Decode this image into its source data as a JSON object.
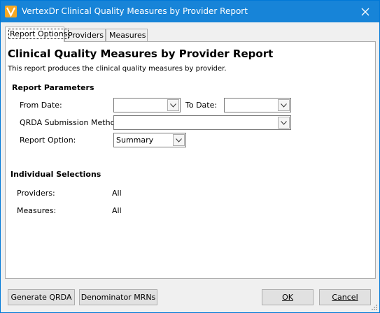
{
  "window": {
    "title": "VertexDr Clinical Quality Measures by Provider Report"
  },
  "tabs": [
    {
      "label": "Report Options",
      "active": true
    },
    {
      "label": "Providers",
      "active": false
    },
    {
      "label": "Measures",
      "active": false
    }
  ],
  "report": {
    "heading": "Clinical Quality Measures by Provider Report",
    "description": "This report produces the clinical quality measures by provider."
  },
  "parameters": {
    "section_title": "Report Parameters",
    "from_date_label": "From Date:",
    "from_date_value": "",
    "to_date_label": "To Date:",
    "to_date_value": "",
    "qrda_label": "QRDA Submission Method",
    "qrda_value": "",
    "report_option_label": "Report Option:",
    "report_option_value": "Summary"
  },
  "selections": {
    "section_title": "Individual Selections",
    "providers_label": "Providers:",
    "providers_value": "All",
    "measures_label": "Measures:",
    "measures_value": "All"
  },
  "buttons": {
    "generate_qrda": "Generate QRDA",
    "denominator_mrns": "Denominator MRNs",
    "ok": "OK",
    "cancel": "Cancel"
  },
  "colors": {
    "titlebar": "#1784d8",
    "app_icon": "#f7a823"
  },
  "icons": {
    "app": "vertexdr-logo-icon",
    "close": "close-icon",
    "dropdown": "chevron-down-icon"
  }
}
